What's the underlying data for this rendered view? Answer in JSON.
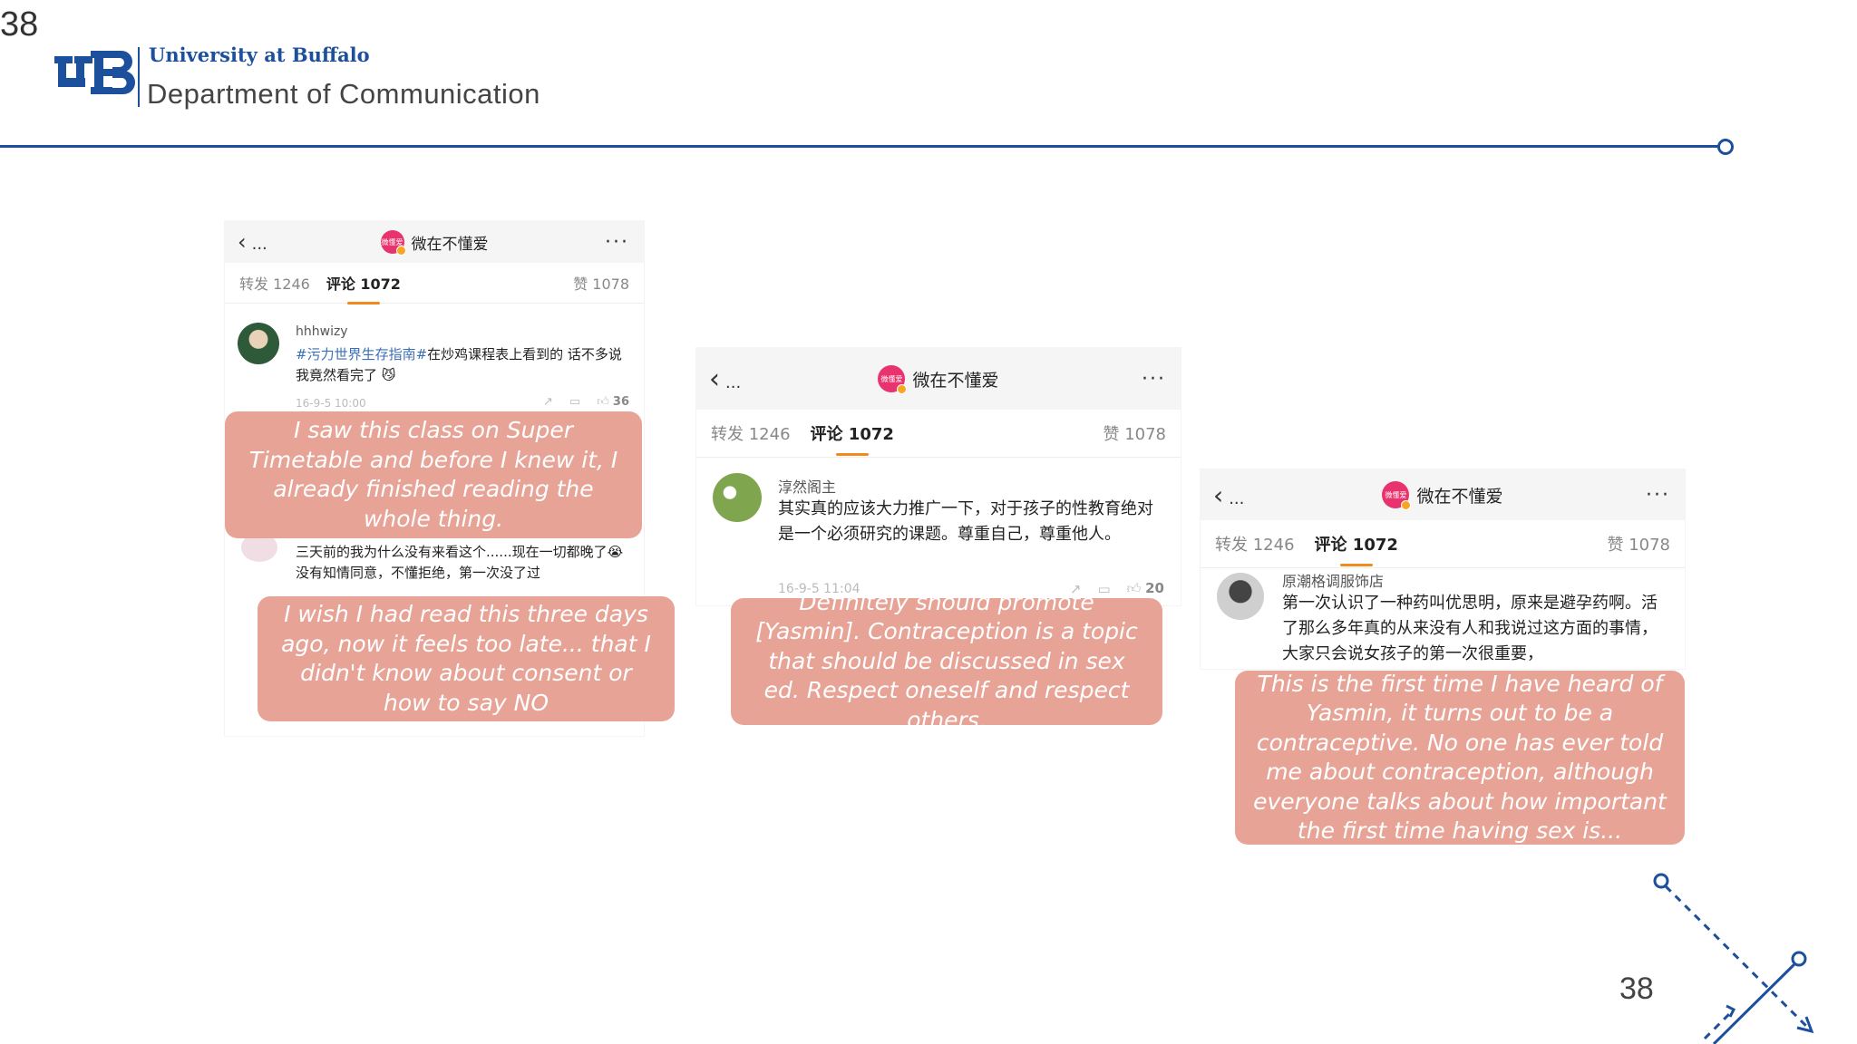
{
  "slide_number": "38",
  "header": {
    "university": "University at Buffalo",
    "department": "Department of Communication"
  },
  "screens": [
    {
      "account": "微在不懂爱",
      "avatar_text": "微懂爱",
      "back_dots": "...",
      "tabs": {
        "reposts": "转发 1246",
        "comments": "评论 1072",
        "likes": "赞 1078"
      },
      "comments": [
        {
          "user": "hhhwizy",
          "hashtag": "#污力世界生存指南#",
          "text": "在炒鸡课程表上看到的 话不多说 我竟然看完了",
          "emoji": "😼",
          "time": "16-9-5 10:00",
          "likes": "36"
        },
        {
          "user": "",
          "text": "三天前的我为什么没有来看这个......现在一切都晚了😭没有知情同意，不懂拒绝，第一次没了过"
        }
      ],
      "bubbles": [
        "I saw this class on Super Timetable and before I knew it, I already finished reading the whole thing.",
        "I wish I had read this three days ago, now it feels too late... that I didn't know about consent or how to say NO"
      ]
    },
    {
      "account": "微在不懂爱",
      "avatar_text": "微懂爱",
      "back_dots": "...",
      "tabs": {
        "reposts": "转发 1246",
        "comments": "评论 1072",
        "likes": "赞 1078"
      },
      "comments": [
        {
          "user": "淳然阁主",
          "text": "其实真的应该大力推广一下，对于孩子的性教育绝对是一个必须研究的课题。尊重自己，尊重他人。",
          "time": "16-9-5 11:04",
          "likes": "20"
        }
      ],
      "bubbles": [
        "Definitely should promote [Yasmin]. Contraception is a topic that should be discussed in sex ed. Respect oneself and respect others."
      ]
    },
    {
      "account": "微在不懂爱",
      "avatar_text": "微懂爱",
      "back_dots": "...",
      "tabs": {
        "reposts": "转发 1246",
        "comments": "评论 1072",
        "likes": "赞 1078"
      },
      "comments": [
        {
          "user": "原潮格调服饰店",
          "text": "第一次认识了一种药叫优思明，原来是避孕药啊。活了那么多年真的从来没有人和我说过这方面的事情，大家只会说女孩子的第一次很重要，"
        }
      ],
      "bubbles": [
        "This is the first time I have heard of Yasmin, it turns out to be a contraceptive. No one has ever told me about contraception, although everyone talks about how important the first time having sex is..."
      ]
    }
  ],
  "colors": {
    "brand_blue": "#1c4f9c",
    "bubble": "#e8a397",
    "tab_underline": "#f08a1c",
    "hashtag": "#3b6fb6",
    "avatar_pink": "#e8336e"
  },
  "icons": [
    "back-chevron-icon",
    "more-dots-icon",
    "share-icon",
    "comment-icon",
    "like-icon"
  ]
}
